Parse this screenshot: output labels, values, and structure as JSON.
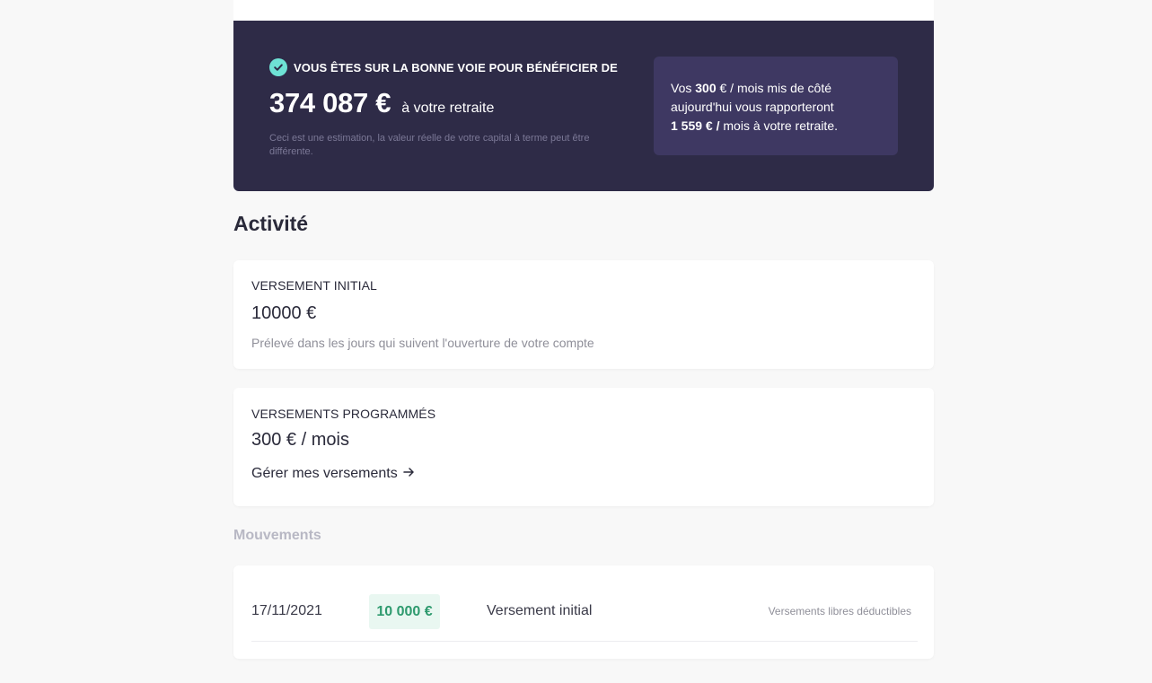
{
  "hero": {
    "headline": "VOUS ÊTES SUR LA BONNE VOIE POUR BÉNÉFICIER DE",
    "amount": "374 087 €",
    "amount_suffix": "à votre retraite",
    "note": "Ceci est une estimation, la valeur réelle de votre capital à terme peut être différente.",
    "box": {
      "prefix": "Vos ",
      "monthly_amount": "300",
      "monthly_unit": " € / ",
      "line1_rest": "mois mis de côté aujourd'hui vous rapporteront",
      "future_amount": "1 559 € /",
      "future_rest": " mois à votre retraite."
    },
    "check_icon": "check-circle-icon",
    "accent_color": "#6ee2d5",
    "background_color": "#2e2b47"
  },
  "activity": {
    "title": "Activité",
    "initial": {
      "label": "VERSEMENT INITIAL",
      "value": "10000 €",
      "note": "Prélevé dans les jours qui suivent l'ouverture de votre compte"
    },
    "programmed": {
      "label": "VERSEMENTS PROGRAMMÉS",
      "value": "300 € / mois",
      "link": "Gérer mes versements",
      "link_icon": "arrow-right-icon"
    }
  },
  "movements": {
    "title": "Mouvements",
    "rows": [
      {
        "date": "17/11/2021",
        "amount": "10 000 €",
        "label": "Versement initial",
        "type": "Versements libres déductibles"
      }
    ],
    "amount_color": "#2e9a6e"
  }
}
